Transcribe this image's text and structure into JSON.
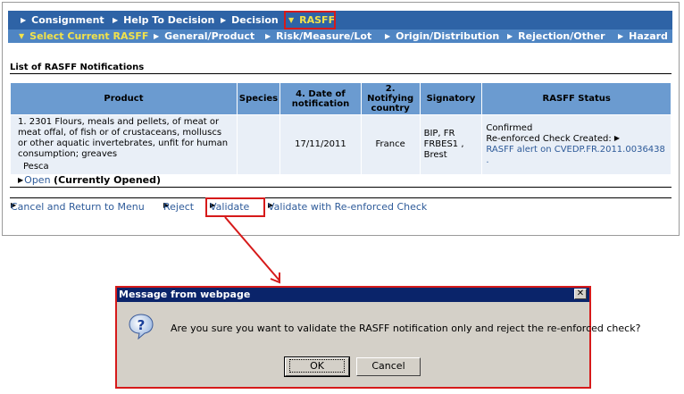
{
  "nav_primary": {
    "items": [
      {
        "label": "Consignment"
      },
      {
        "label": "Help To Decision"
      },
      {
        "label": "Decision"
      },
      {
        "label": "RASFF"
      }
    ]
  },
  "nav_secondary": {
    "items": [
      {
        "label": "Select Current RASFF"
      },
      {
        "label": "General/Product"
      },
      {
        "label": "Risk/Measure/Lot"
      },
      {
        "label": "Origin/Distribution"
      },
      {
        "label": "Rejection/Other"
      },
      {
        "label": "Hazard"
      }
    ]
  },
  "list": {
    "title": "List of RASFF Notifications",
    "columns": {
      "product": "Product",
      "species": "Species",
      "date": "4. Date of notification",
      "country_line1": "2.",
      "country_line2": "Notifying country",
      "signatory": "Signatory",
      "status": "RASFF Status"
    },
    "row": {
      "product": "1. 2301 Flours, meals and pellets, of meat or meat offal, of fish or of crustaceans, molluscs or other aquatic invertebrates, unfit for human consumption; greaves",
      "product_sub": "Pesca",
      "species": "",
      "date": "17/11/2011",
      "country": "France",
      "signatory": "BIP, FR FRBES1 , Brest",
      "status_line1": "Confirmed",
      "status_line2": "Re-enforced Check Created:",
      "status_link": "RASFF alert on CVEDP.FR.2011.0036438 ."
    },
    "open_link": "Open",
    "open_note": "(Currently Opened)"
  },
  "actions": {
    "cancel": "Cancel and Return to Menu",
    "reject": "Reject",
    "validate": "Validate",
    "validate_reenforced": "Validate with Re-enforced Check"
  },
  "dialog": {
    "title": "Message from webpage",
    "close": "✕",
    "message": "Are you sure you want to validate the RASFF notification only and reject the re-enforced check?",
    "ok_label": "OK",
    "cancel_label": "Cancel",
    "icon": "question-icon"
  },
  "colors": {
    "nav_primary_bg": "#2e63a6",
    "nav_secondary_bg": "#4f85c3",
    "active_tab_text": "#f2e24a",
    "highlight": "#d61a1a",
    "table_header": "#6b9bd0",
    "table_row": "#e9eff7",
    "dialog_title_bg": "#0a246a"
  }
}
